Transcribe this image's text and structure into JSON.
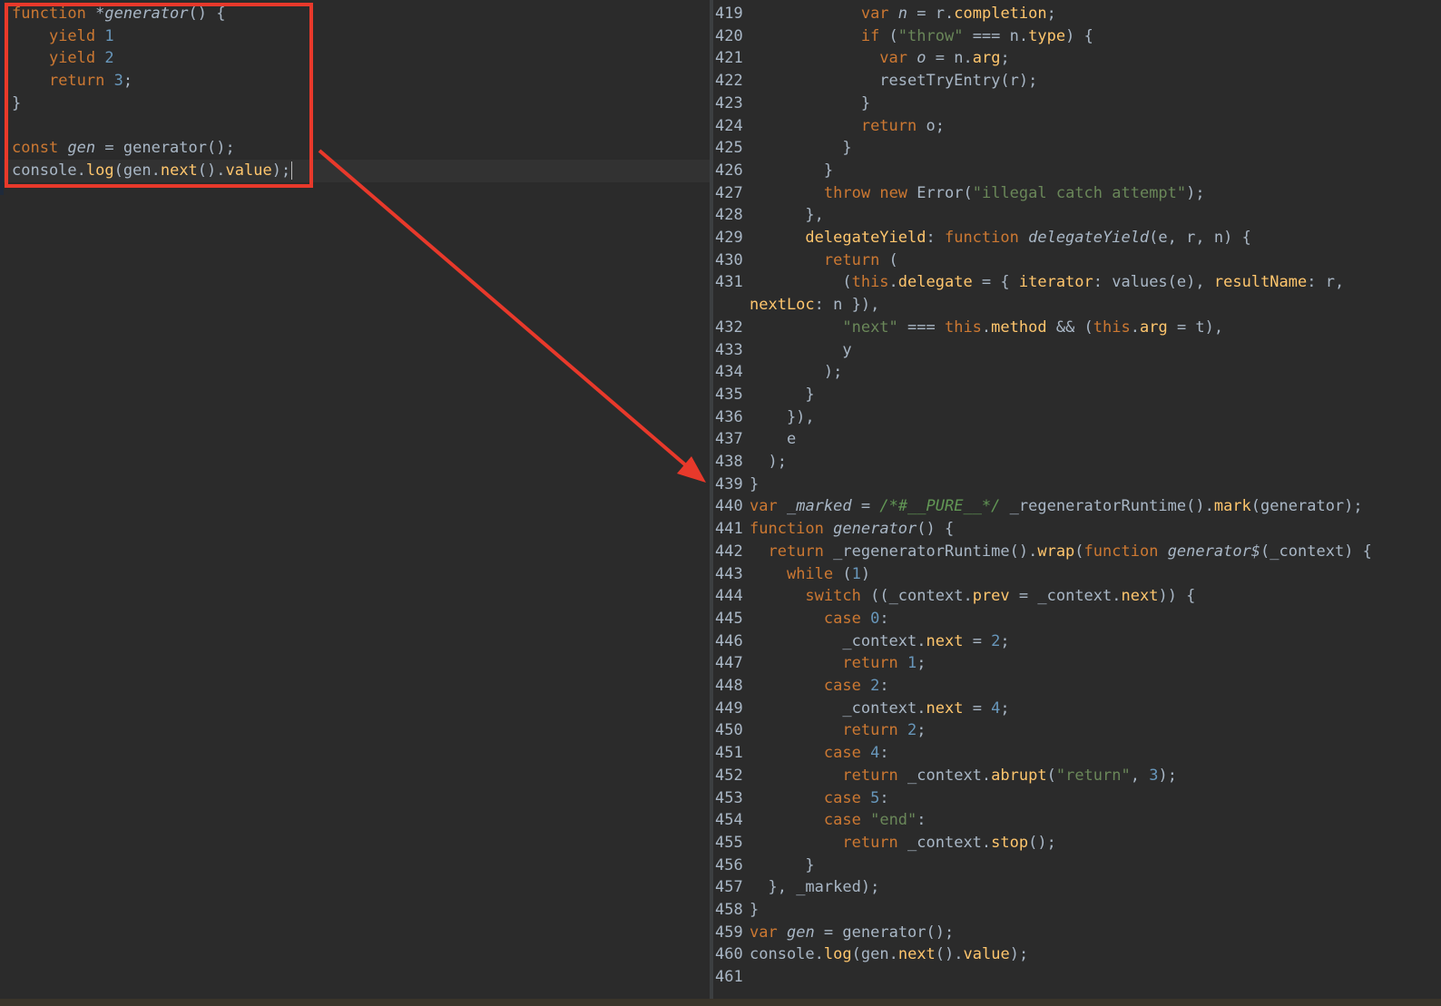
{
  "left_editor": {
    "lines": [
      "function *generator() {",
      "    yield 1",
      "    yield 2",
      "    return 3;",
      "}",
      "",
      "const gen = generator();",
      "console.log(gen.next().value);"
    ]
  },
  "right_editor": {
    "line_numbers": [
      "419",
      "420",
      "421",
      "422",
      "423",
      "424",
      "425",
      "426",
      "427",
      "428",
      "429",
      "430",
      "431",
      "",
      "432",
      "433",
      "434",
      "435",
      "436",
      "437",
      "438",
      "439",
      "440",
      "441",
      "442",
      "443",
      "444",
      "445",
      "446",
      "447",
      "448",
      "449",
      "450",
      "451",
      "452",
      "453",
      "454",
      "455",
      "456",
      "457",
      "458",
      "459",
      "460",
      "461"
    ],
    "lines": [
      "            var n = r.completion;",
      "            if (\"throw\" === n.type) {",
      "              var o = n.arg;",
      "              resetTryEntry(r);",
      "            }",
      "            return o;",
      "          }",
      "        }",
      "        throw new Error(\"illegal catch attempt\");",
      "      },",
      "      delegateYield: function delegateYield(e, r, n) {",
      "        return (",
      "          (this.delegate = { iterator: values(e), resultName: r,",
      "nextLoc: n }),",
      "          \"next\" === this.method && (this.arg = t),",
      "          y",
      "        );",
      "      }",
      "    }),",
      "    e",
      "  );",
      "}",
      "var _marked = /*#__PURE__*/ _regeneratorRuntime().mark(generator);",
      "function generator() {",
      "  return _regeneratorRuntime().wrap(function generator$(_context) {",
      "    while (1)",
      "      switch ((_context.prev = _context.next)) {",
      "        case 0:",
      "          _context.next = 2;",
      "          return 1;",
      "        case 2:",
      "          _context.next = 4;",
      "          return 2;",
      "        case 4:",
      "          return _context.abrupt(\"return\", 3);",
      "        case 5:",
      "        case \"end\":",
      "          return _context.stop();",
      "      }",
      "  }, _marked);",
      "}",
      "var gen = generator();",
      "console.log(gen.next().value);",
      ""
    ]
  },
  "colors": {
    "background": "#2b2b2b",
    "keyword": "#cc7832",
    "number": "#6897bb",
    "string": "#6a8759",
    "function_call": "#ffc66d",
    "plain": "#a9b7c6",
    "highlight_box": "#e8392b",
    "arrow": "#e8392b"
  }
}
